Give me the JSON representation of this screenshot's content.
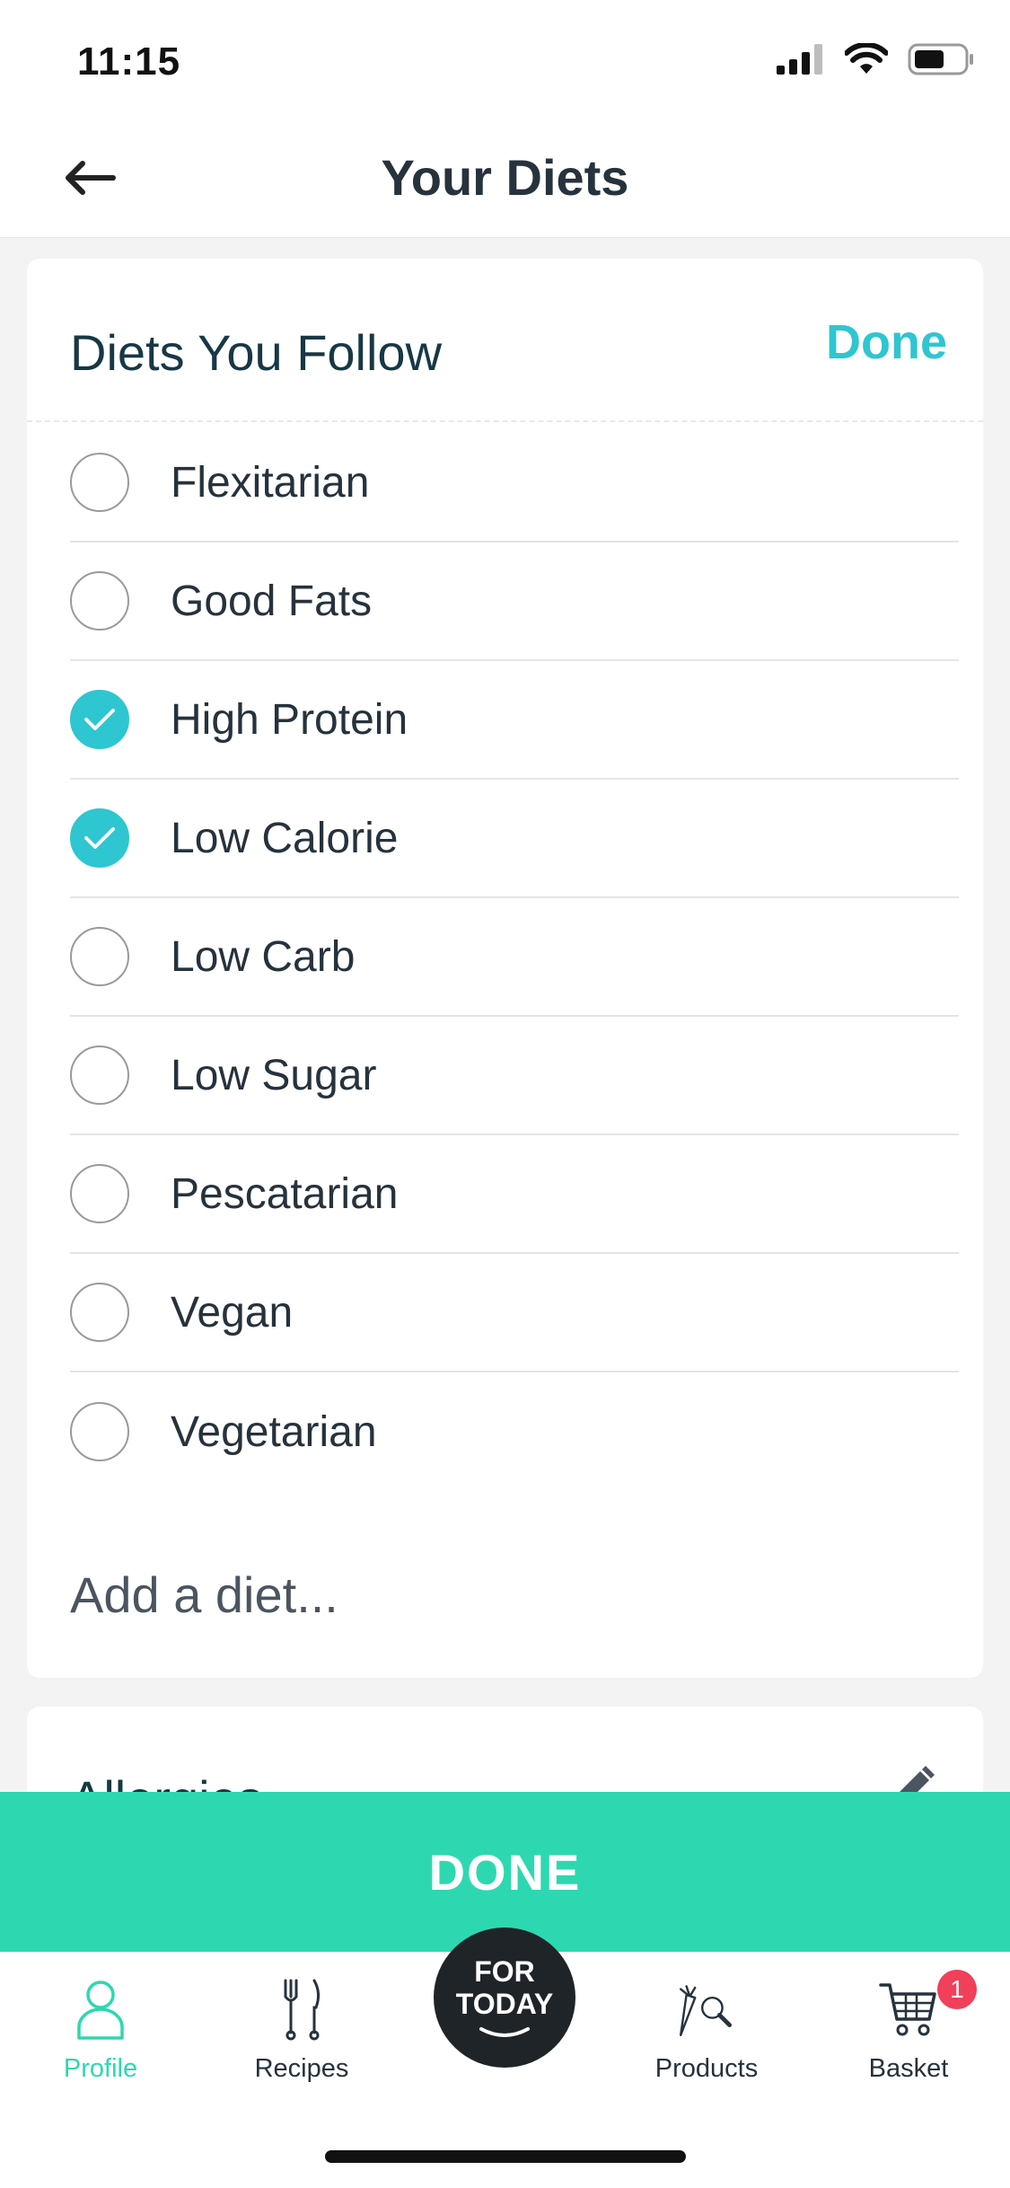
{
  "status_bar": {
    "time": "11:15"
  },
  "header": {
    "title": "Your Diets"
  },
  "diets_card": {
    "title": "Diets You Follow",
    "done_label": "Done",
    "items": [
      {
        "label": "Flexitarian",
        "checked": false
      },
      {
        "label": "Good Fats",
        "checked": false
      },
      {
        "label": "High Protein",
        "checked": true
      },
      {
        "label": "Low Calorie",
        "checked": true
      },
      {
        "label": "Low Carb",
        "checked": false
      },
      {
        "label": "Low Sugar",
        "checked": false
      },
      {
        "label": "Pescatarian",
        "checked": false
      },
      {
        "label": "Vegan",
        "checked": false
      },
      {
        "label": "Vegetarian",
        "checked": false
      }
    ],
    "add_placeholder": "Add a diet..."
  },
  "allergies_card": {
    "title": "Allergies"
  },
  "done_button": {
    "label": "DONE"
  },
  "tab_bar": {
    "profile": "Profile",
    "recipes": "Recipes",
    "for_today_line1": "FOR",
    "for_today_line2": "TODAY",
    "products": "Products",
    "basket": "Basket",
    "basket_badge": "1",
    "active": "profile"
  },
  "colors": {
    "accent": "#2ec6d0",
    "done_bar": "#2dd8b0",
    "badge": "#f0405a"
  }
}
